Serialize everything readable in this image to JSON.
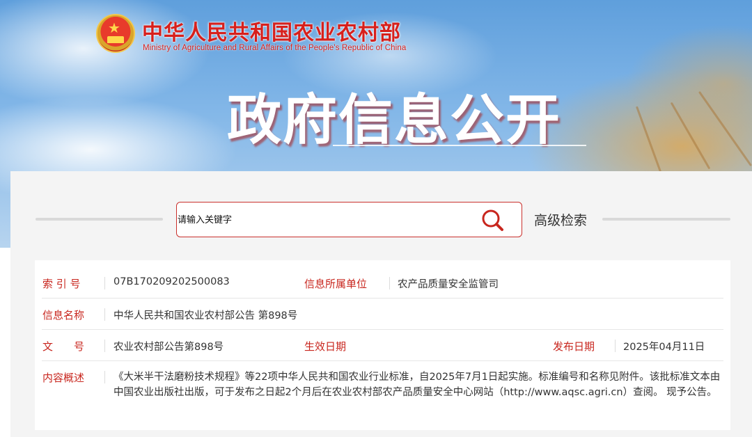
{
  "header": {
    "ministry_name_cn": "中华人民共和国农业农村部",
    "ministry_name_en": "Ministry of Agriculture and Rural Affairs of the People's Republic of China",
    "banner_title": "政府信息公开"
  },
  "search": {
    "placeholder": "请输入关键字",
    "advanced_label": "高级检索"
  },
  "info": {
    "index_label": "索 引 号",
    "index_value": "07B170209202500083",
    "unit_label": "信息所属单位",
    "unit_value": "农产品质量安全监管司",
    "name_label": "信息名称",
    "name_value": "中华人民共和国农业农村部公告 第898号",
    "doc_label": "文　　号",
    "doc_value": "农业农村部公告第898号",
    "effective_label": "生效日期",
    "effective_value": "",
    "publish_label": "发布日期",
    "publish_value": "2025年04月11日",
    "summary_label": "内容概述",
    "summary_value": "《大米半干法磨粉技术规程》等22项中华人民共和国农业行业标准，自2025年7月1日起实施。标准编号和名称见附件。该批标准文本由中国农业出版社出版，可于发布之日起2个月后在农业农村部农产品质量安全中心网站（http://www.aqsc.agri.cn）查阅。 现予公告。"
  },
  "colors": {
    "accent_red": "#c8261e",
    "panel_bg": "#f4f4f4"
  }
}
